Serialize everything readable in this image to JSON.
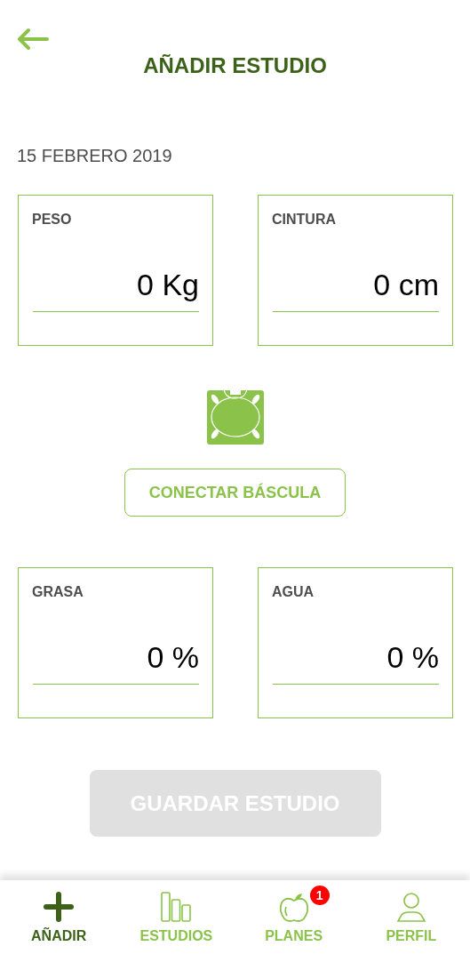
{
  "header": {
    "title": "AÑADIR ESTUDIO"
  },
  "date": "15 FEBRERO 2019",
  "measures_top": [
    {
      "label": "PESO",
      "value": "0 Kg"
    },
    {
      "label": "CINTURA",
      "value": "0 cm"
    }
  ],
  "connect_button": {
    "label": "CONECTAR BÁSCULA"
  },
  "measures_bottom": [
    {
      "label": "GRASA",
      "value": "0 %"
    },
    {
      "label": "AGUA",
      "value": "0 %"
    }
  ],
  "save_button": {
    "label": "GUARDAR ESTUDIO",
    "disabled": true
  },
  "nav": [
    {
      "kind": "add",
      "label": "AÑADIR",
      "selected": true
    },
    {
      "kind": "studies",
      "label": "ESTUDIOS",
      "selected": false
    },
    {
      "kind": "plans",
      "label": "PLANES",
      "selected": false,
      "badge": "1"
    },
    {
      "kind": "profile",
      "label": "PERFIL",
      "selected": false
    }
  ]
}
